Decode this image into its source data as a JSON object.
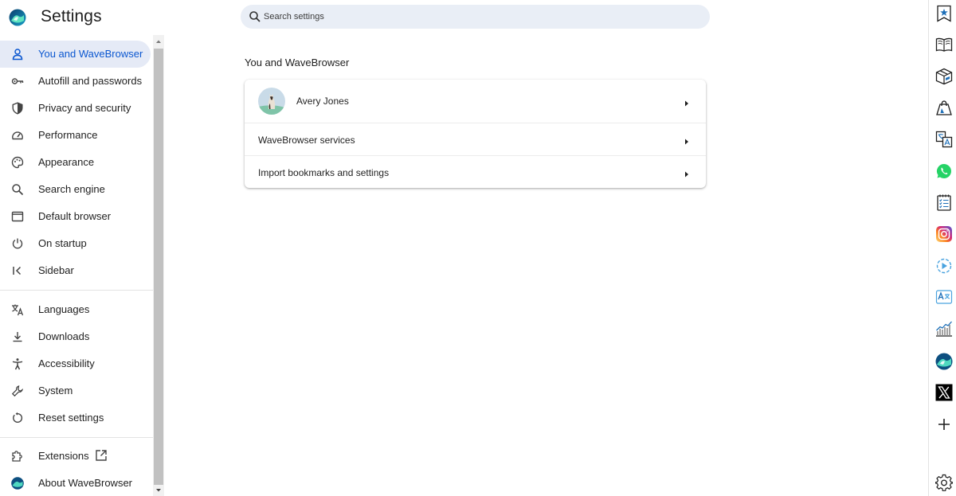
{
  "app": {
    "title": "Settings",
    "logo_icon": "wavebrowser-logo-icon"
  },
  "search": {
    "placeholder": "Search settings",
    "value": ""
  },
  "sidebar": {
    "items": [
      {
        "label": "You and WaveBrowser",
        "icon": "person-icon",
        "active": true
      },
      {
        "label": "Autofill and passwords",
        "icon": "key-icon"
      },
      {
        "label": "Privacy and security",
        "icon": "shield-icon"
      },
      {
        "label": "Performance",
        "icon": "speedometer-icon"
      },
      {
        "label": "Appearance",
        "icon": "palette-icon"
      },
      {
        "label": "Search engine",
        "icon": "search-icon"
      },
      {
        "label": "Default browser",
        "icon": "browser-window-icon"
      },
      {
        "label": "On startup",
        "icon": "power-icon"
      },
      {
        "label": "Sidebar",
        "icon": "collapse-sidebar-icon"
      },
      {
        "label": "Languages",
        "icon": "translate-icon"
      },
      {
        "label": "Downloads",
        "icon": "download-icon"
      },
      {
        "label": "Accessibility",
        "icon": "accessibility-icon"
      },
      {
        "label": "System",
        "icon": "wrench-icon"
      },
      {
        "label": "Reset settings",
        "icon": "reset-icon"
      },
      {
        "label": "Extensions",
        "icon": "puzzle-icon",
        "trailing_icon": "open-in-new-icon"
      },
      {
        "label": "About WaveBrowser",
        "icon": "wavebrowser-logo-icon"
      }
    ]
  },
  "main": {
    "section_title": "You and WaveBrowser",
    "rows": [
      {
        "label": "Avery Jones",
        "icon": "avatar"
      },
      {
        "label": "WaveBrowser services"
      },
      {
        "label": "Import bookmarks and settings"
      }
    ]
  },
  "right_toolbar": {
    "icons": [
      "bookmark-star-icon",
      "reading-book-icon",
      "package-box-icon",
      "shopping-bag-icon",
      "translate-doc-icon",
      "whatsapp-icon",
      "notepad-list-icon",
      "instagram-icon",
      "video-player-icon",
      "text-translate-icon",
      "stock-chart-icon",
      "wavebrowser-logo-icon",
      "x-twitter-icon",
      "add-icon",
      "settings-gear-icon"
    ]
  },
  "colors": {
    "accent": "#0b57d0",
    "active_bg": "#e5eaf6",
    "search_bg": "#e9eef6",
    "whatsapp": "#25d366",
    "instagram": "#e1306c"
  }
}
